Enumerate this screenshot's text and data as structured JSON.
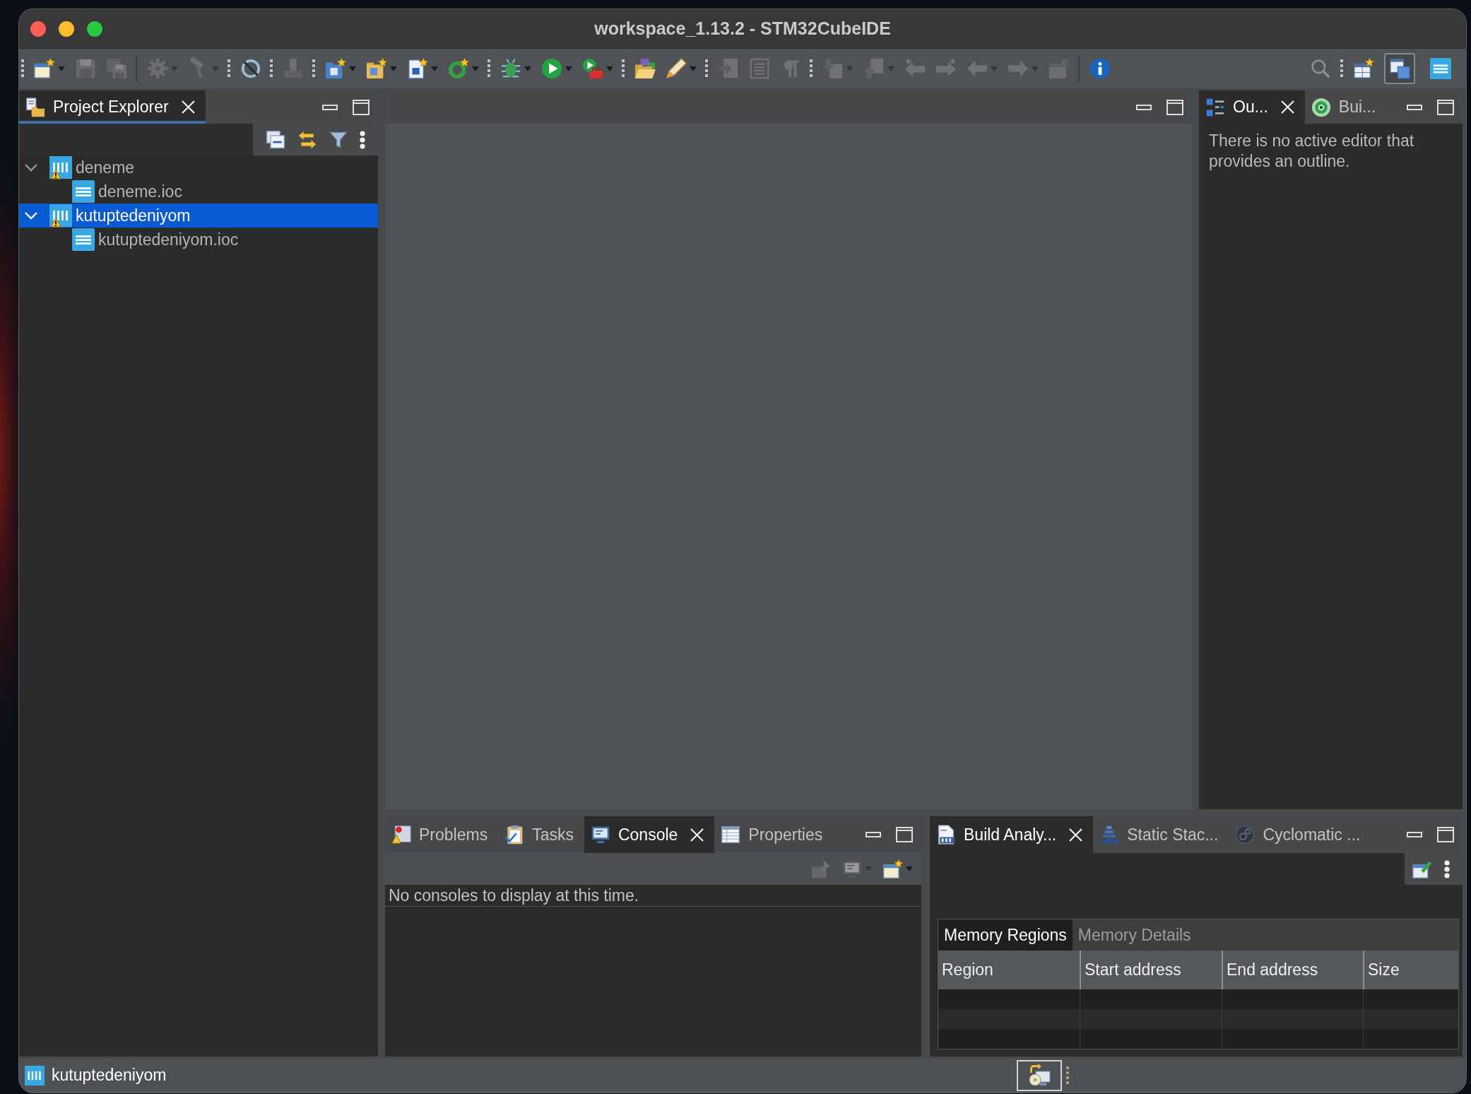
{
  "window": {
    "title": "workspace_1.13.2 - STM32CubeIDE"
  },
  "toolbar": {
    "groups": [
      {
        "kind": "grip",
        "items": [
          {
            "disabled": false,
            "menu": true
          },
          {
            "disabled": true,
            "menu": false
          },
          {
            "disabled": true,
            "menu": false
          }
        ]
      },
      {
        "kind": "line",
        "items": [
          {
            "disabled": true,
            "menu": true
          },
          {
            "disabled": true,
            "menu": true
          }
        ]
      },
      {
        "kind": "grip",
        "items": [
          {
            "disabled": false,
            "menu": false
          }
        ]
      },
      {
        "kind": "grip",
        "items": [
          {
            "disabled": true,
            "menu": false
          }
        ]
      },
      {
        "kind": "grip",
        "items": [
          {
            "disabled": false,
            "menu": true
          },
          {
            "disabled": false,
            "menu": true
          },
          {
            "disabled": false,
            "menu": true
          },
          {
            "disabled": false,
            "menu": true
          }
        ]
      },
      {
        "kind": "grip",
        "items": [
          {
            "disabled": false,
            "menu": true
          },
          {
            "disabled": false,
            "menu": true
          },
          {
            "disabled": false,
            "menu": true
          }
        ]
      },
      {
        "kind": "grip",
        "items": [
          {
            "disabled": false,
            "menu": false
          },
          {
            "disabled": false,
            "menu": true
          }
        ]
      },
      {
        "kind": "grip",
        "items": [
          {
            "disabled": true,
            "menu": false
          },
          {
            "disabled": true,
            "menu": false
          },
          {
            "disabled": true,
            "menu": false
          }
        ]
      },
      {
        "kind": "grip",
        "items": [
          {
            "disabled": true,
            "menu": true
          },
          {
            "disabled": true,
            "menu": true
          },
          {
            "disabled": true,
            "menu": false
          },
          {
            "disabled": true,
            "menu": false
          },
          {
            "disabled": true,
            "menu": true
          },
          {
            "disabled": true,
            "menu": true
          },
          {
            "disabled": true,
            "menu": false
          }
        ]
      },
      {
        "kind": "line",
        "items": [
          {
            "disabled": false,
            "menu": false
          }
        ]
      }
    ],
    "perspectives": [
      {
        "selected": true
      },
      {
        "selected": false
      }
    ]
  },
  "project_explorer": {
    "active": true,
    "tabs": [
      {
        "label": "Project Explorer",
        "selected": true
      }
    ],
    "tree": [
      {
        "kind": "project",
        "label": "deneme",
        "warning": true,
        "expanded": true,
        "selected": false,
        "children": [
          {
            "kind": "file",
            "label": "deneme.ioc",
            "selected": false
          }
        ]
      },
      {
        "kind": "project",
        "label": "kutuptedeniyom",
        "warning": true,
        "expanded": true,
        "selected": true,
        "children": [
          {
            "kind": "file",
            "label": "kutuptedeniyom.ioc",
            "selected": false
          }
        ]
      }
    ]
  },
  "outline": {
    "active": false,
    "tabs": [
      {
        "label": "Ou...",
        "selected": true
      },
      {
        "label": "Bui...",
        "selected": false
      }
    ],
    "message": "There is no active editor that provides an outline."
  },
  "console": {
    "active": false,
    "tabs": [
      {
        "label": "Problems",
        "selected": false
      },
      {
        "label": "Tasks",
        "selected": false
      },
      {
        "label": "Console",
        "selected": true
      },
      {
        "label": "Properties",
        "selected": false
      }
    ],
    "toolbar": [
      {
        "disabled": true,
        "menu": false
      },
      {
        "disabled": true,
        "menu": true
      },
      {
        "disabled": false,
        "menu": true
      }
    ],
    "message": "No consoles to display at this time."
  },
  "build_analyzer": {
    "active": false,
    "tabs": [
      {
        "label": "Build Analy...",
        "selected": true
      },
      {
        "label": "Static Stac...",
        "selected": false
      },
      {
        "label": "Cyclomatic ...",
        "selected": false
      }
    ],
    "subtabs": [
      {
        "label": "Memory Regions",
        "selected": true
      },
      {
        "label": "Memory Details",
        "selected": false
      }
    ],
    "table": {
      "columns": [
        "Region",
        "Start address",
        "End address",
        "Size"
      ]
    }
  },
  "status_bar": {
    "text": "kutuptedeniyom"
  }
}
